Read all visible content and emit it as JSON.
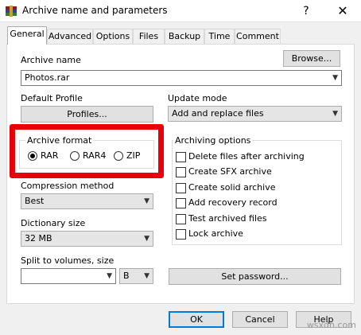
{
  "window": {
    "title": "Archive name and parameters",
    "help_glyph": "?",
    "close_glyph": "✕"
  },
  "tabs": [
    {
      "label": "General",
      "active": true
    },
    {
      "label": "Advanced"
    },
    {
      "label": "Options"
    },
    {
      "label": "Files"
    },
    {
      "label": "Backup"
    },
    {
      "label": "Time"
    },
    {
      "label": "Comment"
    }
  ],
  "archive_name": {
    "label": "Archive name",
    "value": "Photos.rar",
    "browse_label": "Browse..."
  },
  "default_profile": {
    "label": "Default Profile",
    "button_label": "Profiles..."
  },
  "update_mode": {
    "label": "Update mode",
    "value": "Add and replace files"
  },
  "archive_format": {
    "label": "Archive format",
    "options": [
      {
        "label": "RAR",
        "selected": true
      },
      {
        "label": "RAR4",
        "selected": false
      },
      {
        "label": "ZIP",
        "selected": false
      }
    ]
  },
  "archiving_options": {
    "label": "Archiving options",
    "items": [
      {
        "label": "Delete files after archiving",
        "checked": false
      },
      {
        "label": "Create SFX archive",
        "checked": false
      },
      {
        "label": "Create solid archive",
        "checked": false
      },
      {
        "label": "Add recovery record",
        "checked": false
      },
      {
        "label": "Test archived files",
        "checked": false
      },
      {
        "label": "Lock archive",
        "checked": false
      }
    ]
  },
  "compression_method": {
    "label": "Compression method",
    "value": "Best"
  },
  "dictionary_size": {
    "label": "Dictionary size",
    "value": "32 MB"
  },
  "split_volumes": {
    "label": "Split to volumes, size",
    "value": "",
    "unit": "B"
  },
  "set_password_label": "Set password...",
  "footer": {
    "ok": "OK",
    "cancel": "Cancel",
    "help": "Help"
  },
  "watermark": "wsxdn.com",
  "colors": {
    "highlight_box": "#e8000b",
    "default_button_border": "#0078d7"
  }
}
